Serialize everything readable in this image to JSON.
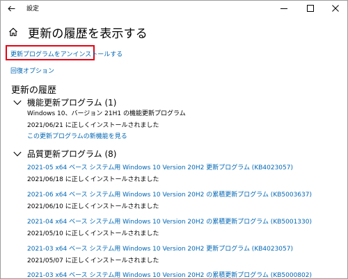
{
  "window": {
    "title": "設定"
  },
  "header": {
    "title": "更新の履歴を表示する"
  },
  "links": {
    "uninstall": "更新プログラムをアンインストールする",
    "recovery": "回復オプション"
  },
  "history": {
    "section_title": "更新の履歴",
    "feature_group": {
      "label": "機能更新プログラム (1)",
      "items": [
        {
          "name": "Windows 10、バージョン 21H1 の機能更新プログラム",
          "status": "2021/06/21 に正しくインストールされました",
          "extra_link": "この更新プログラムの新機能を見る"
        }
      ]
    },
    "quality_group": {
      "label": "品質更新プログラム (8)",
      "items": [
        {
          "name": "2021-05 x64 ベース システム用 Windows 10 Version 20H2 更新プログラム (KB4023057)",
          "status": "2021/06/18 に正しくインストールされました"
        },
        {
          "name": "2021-06 x64 ベース システム用 Windows 10 Version 20H2 の累積更新プログラム (KB5003637)",
          "status": "2021/06/10 に正しくインストールされました"
        },
        {
          "name": "2021-04 x64 ベース システム用 Windows 10 Version 20H2 の累積更新プログラム (KB5001330)",
          "status": "2021/05/10 に正しくインストールされました"
        },
        {
          "name": "2021-03 x64 ベース システム用 Windows 10 Version 20H2 更新プログラム (KB4023057)",
          "status": "2021/05/07 に正しくインストールされました"
        },
        {
          "name": "2021-03 x64 ベース システム用 Windows 10 Version 20H2 の累積更新プログラム (KB5000802)",
          "status": ""
        }
      ]
    }
  },
  "colors": {
    "link": "#0066b4",
    "highlight": "#e60012"
  },
  "icons": {
    "back": "back-arrow-icon",
    "home": "home-icon",
    "minimize": "minimize-icon",
    "maximize": "maximize-icon",
    "close": "close-icon",
    "chevron": "chevron-down-icon"
  }
}
